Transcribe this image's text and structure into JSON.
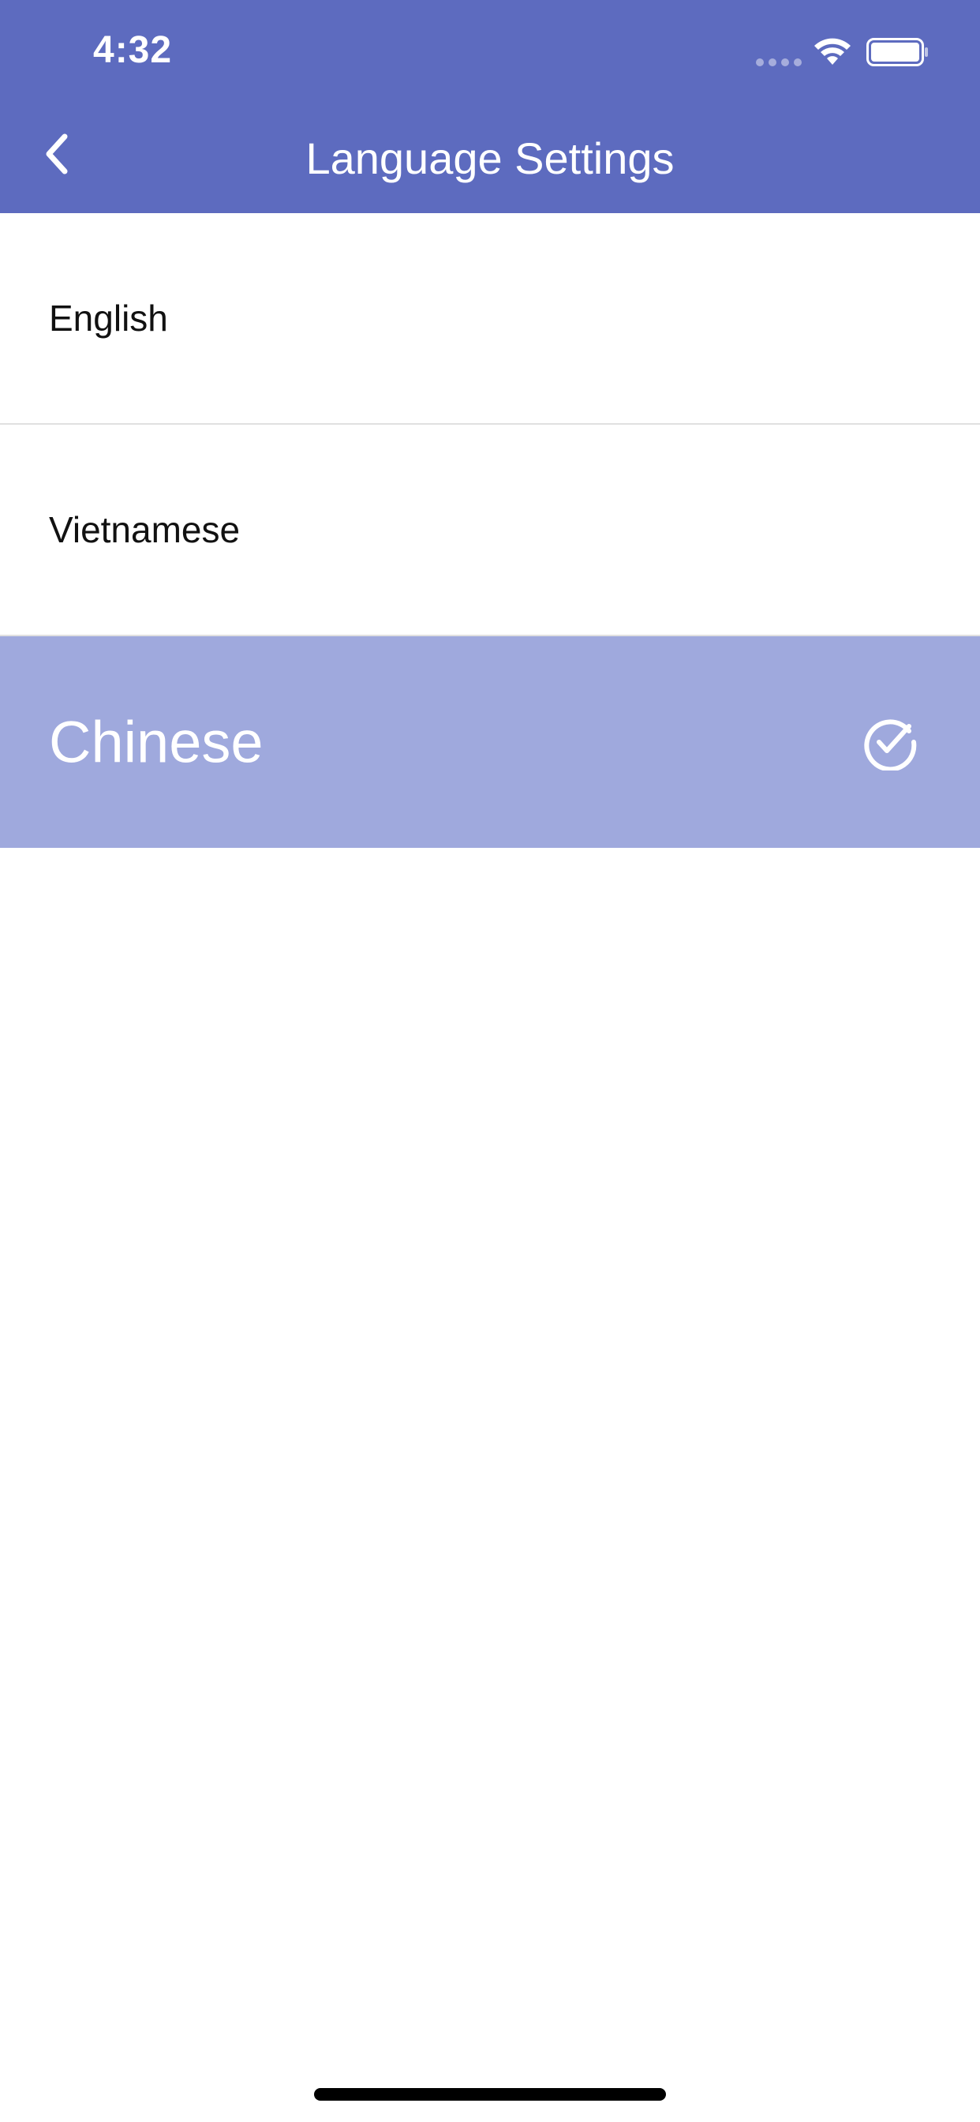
{
  "status_bar": {
    "time": "4:32"
  },
  "header": {
    "title": "Language Settings",
    "back_icon": "chevron-left-icon",
    "background_color": "#5D6BBF"
  },
  "languages": [
    {
      "label": "English",
      "selected": false
    },
    {
      "label": "Vietnamese",
      "selected": false
    },
    {
      "label": "Chinese",
      "selected": true
    }
  ],
  "selected_icon": "check-circle-icon",
  "selected_color": "#9FA9DD"
}
